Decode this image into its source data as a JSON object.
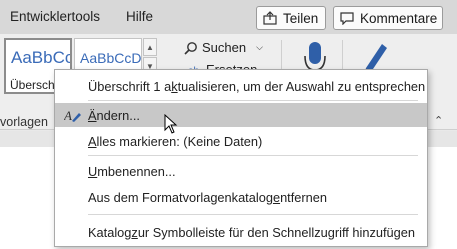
{
  "tabs": [
    {
      "label": "Entwicklertools"
    },
    {
      "label": "Hilfe"
    }
  ],
  "header_buttons": {
    "share": "Teilen",
    "comments": "Kommentare"
  },
  "styles_gallery": {
    "tiles": [
      {
        "preview": "AaBbCc",
        "caption": "Überschr"
      },
      {
        "preview": "AaBbCcD",
        "caption": ""
      }
    ]
  },
  "editing": {
    "search": "Suchen",
    "replace": "Ersetzen"
  },
  "ribbon": {
    "group_label": "vorlagen"
  },
  "context_menu": {
    "items": [
      {
        "pre": "Überschrift 1 a",
        "ul": "k",
        "post": "tualisieren, um der Auswahl zu entsprechen"
      },
      {
        "pre": "",
        "ul": "Ä",
        "post": "ndern..."
      },
      {
        "pre": "",
        "ul": "A",
        "post": "lles markieren: (Keine Daten)"
      },
      {
        "pre": "",
        "ul": "U",
        "post": "mbenennen..."
      },
      {
        "pre": "Aus dem Formatvorlagenkatalog ",
        "ul": "e",
        "post": "ntfernen"
      },
      {
        "pre": "Katalog ",
        "ul": "z",
        "post": "ur Symbolleiste für den Schnellzugriff hinzufügen"
      }
    ]
  },
  "colors": {
    "accent_blue": "#3a6bb8",
    "menu_hover": "#c8c8c8"
  },
  "icons": {
    "share": "share-icon",
    "comment": "comment-icon",
    "search": "search-icon",
    "dictate": "microphone-icon",
    "editor": "editor-pen-icon",
    "modify_style": "modify-style-icon"
  }
}
